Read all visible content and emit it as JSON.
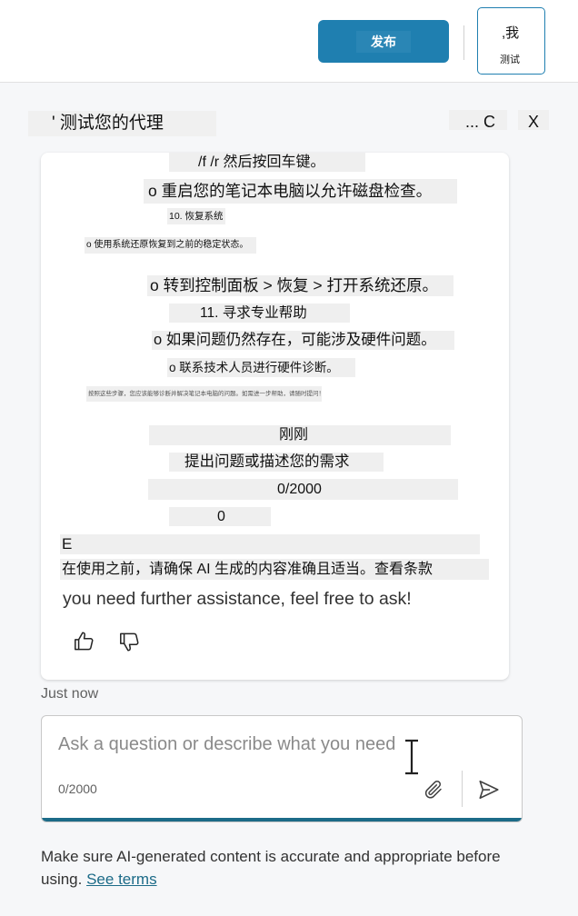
{
  "header": {
    "publish_label": "发布",
    "test_icon_text": ",我",
    "test_label": "测试"
  },
  "panel": {
    "title": "' 测试您的代理",
    "more_label": "... C",
    "close_label": "X"
  },
  "message": {
    "lines": [
      "/f /r 然后按回车键。",
      "o 重启您的笔记本电脑以允许磁盘检查。",
      "10. 恢复系统",
      "o 使用系统还原恢复到之前的稳定状态。",
      "o 转到控制面板 > 恢复 > 打开系统还原。",
      "11. 寻求专业帮助",
      "o 如果问题仍然存在，可能涉及硬件问题。",
      "o 联系技术人员进行硬件诊断。",
      "按照这些步骤，您应该能够诊断并解决笔记本电脑的问题。如需进一步帮助，请随时提问！",
      "刚刚",
      "提出问题或描述您的需求",
      "0/2000",
      "0",
      "E",
      "在使用之前，请确保 AI 生成的内容准确且适当。查看条款"
    ],
    "english_line": "you need further assistance, feel free to ask!",
    "like_icon": "thumbs-up-icon",
    "dislike_icon": "thumbs-down-icon"
  },
  "timestamp": "Just now",
  "composer": {
    "placeholder": "Ask a question or describe what you need",
    "counter": "0/2000",
    "attach_icon": "paperclip-icon",
    "send_icon": "send-icon"
  },
  "footer": {
    "disclaimer_text": "Make sure AI-generated content is accurate and appropriate before using. ",
    "terms_link": "See terms"
  },
  "colors": {
    "accent": "#1f7fb0",
    "link": "#1c6b88"
  }
}
